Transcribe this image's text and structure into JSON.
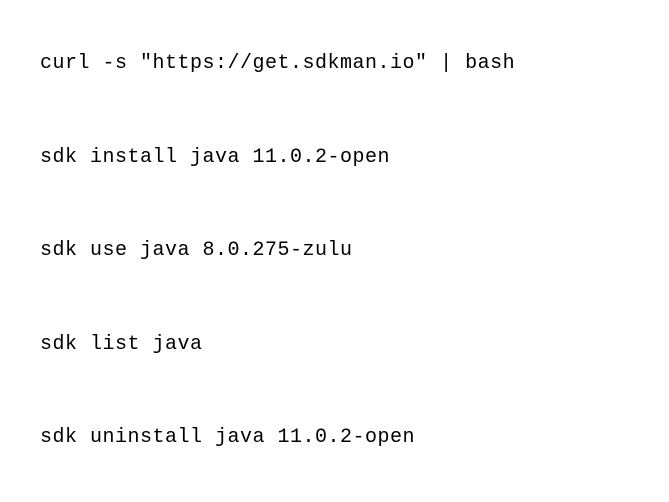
{
  "commands": [
    "curl -s \"https://get.sdkman.io\" | bash",
    "sdk install java 11.0.2-open",
    "sdk use java 8.0.275-zulu",
    "sdk list java",
    "sdk uninstall java 11.0.2-open"
  ]
}
